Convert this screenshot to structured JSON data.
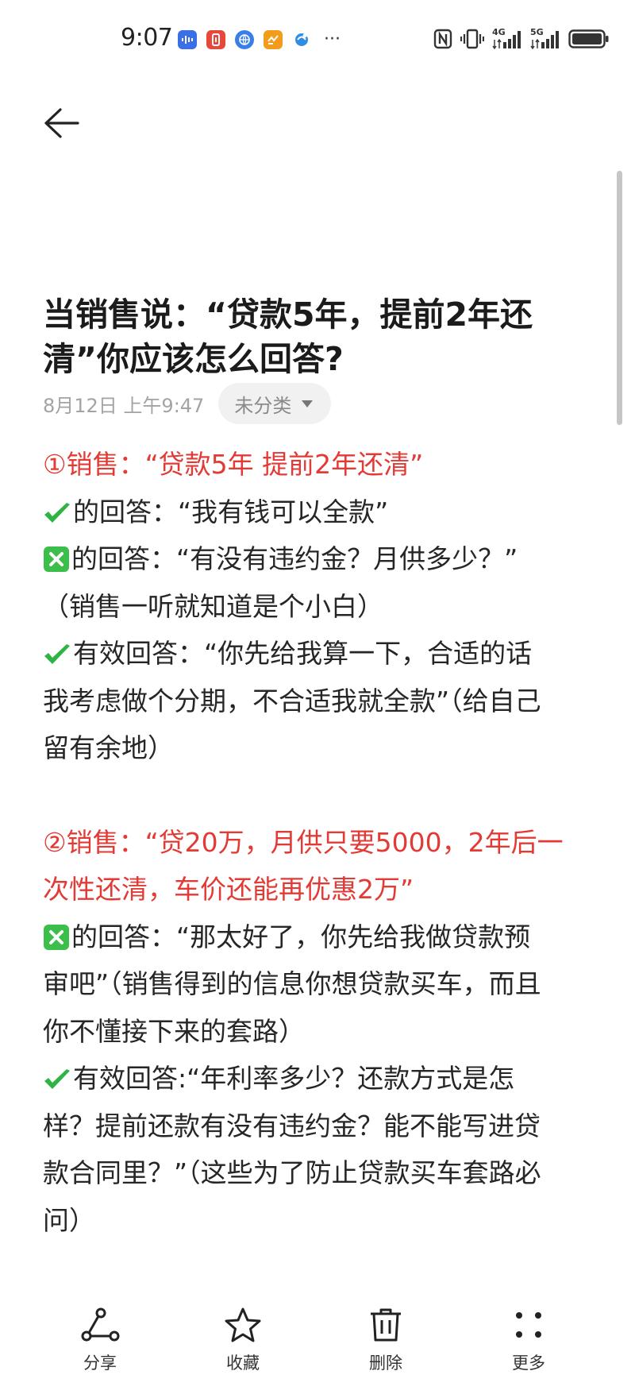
{
  "status_bar": {
    "time": "9:07",
    "more_indicator": "···",
    "notification_icons": [
      {
        "name": "voice-app-icon",
        "color": "#3b6fe6",
        "glyph": "⦙"
      },
      {
        "name": "red-app-icon",
        "color": "#e8483a",
        "glyph": "8"
      },
      {
        "name": "browser-app-icon",
        "color": "#3a7fe8",
        "glyph": "◍"
      },
      {
        "name": "orange-app-icon",
        "color": "#f39c1b",
        "glyph": "✓"
      },
      {
        "name": "blue-app-icon",
        "color": "#2f8de4",
        "glyph": "◐"
      }
    ],
    "system_icons": [
      "nfc-icon",
      "vibrate-icon",
      "signal-4g-icon",
      "signal-5g-icon",
      "battery-icon"
    ],
    "network_labels": {
      "first": "4G",
      "second": "5G"
    }
  },
  "note": {
    "title": "当销售说：“贷款5年，提前2年还清”你应该怎么回答?",
    "title_line1": "当销售说：“贷款5年，提前2年还",
    "title_line2": "清”你应该怎么回答?",
    "date": "8月12日 上午9:47",
    "category": "未分类",
    "body": {
      "l1": "①销售：“贷款5年 提前2年还清”",
      "l2": "的回答：“我有钱可以全款”",
      "l3": "的回答：“有没有违约金？月供多少？”",
      "l4": "（销售一听就知道是个小白）",
      "l5": "有效回答：“你先给我算一下，合适的话",
      "l6": "我考虑做个分期，不合适我就全款”（给自己",
      "l7": "留有余地）",
      "l8": "②销售：“贷20万，月供只要5000，2年后一",
      "l9": "次性还清，车价还能再优惠2万”",
      "l10": "的回答：“那太好了，你先给我做贷款预",
      "l11": "审吧”（销售得到的信息你想贷款买车，而且",
      "l12": "你不懂接下来的套路）",
      "l13": "有效回答:“年利率多少？还款方式是怎",
      "l14": "样？提前还款有没有违约金？能不能写进贷",
      "l15": "款合同里？”（这些为了防止贷款买车套路必",
      "l16": "问）"
    }
  },
  "toolbar": {
    "share": "分享",
    "favorite": "收藏",
    "delete": "删除",
    "more": "更多"
  },
  "colors": {
    "accent_red": "#e23a35",
    "check_green": "#2fb344",
    "cross_green": "#3bbf4a",
    "meta_gray": "#a3a3a3"
  }
}
